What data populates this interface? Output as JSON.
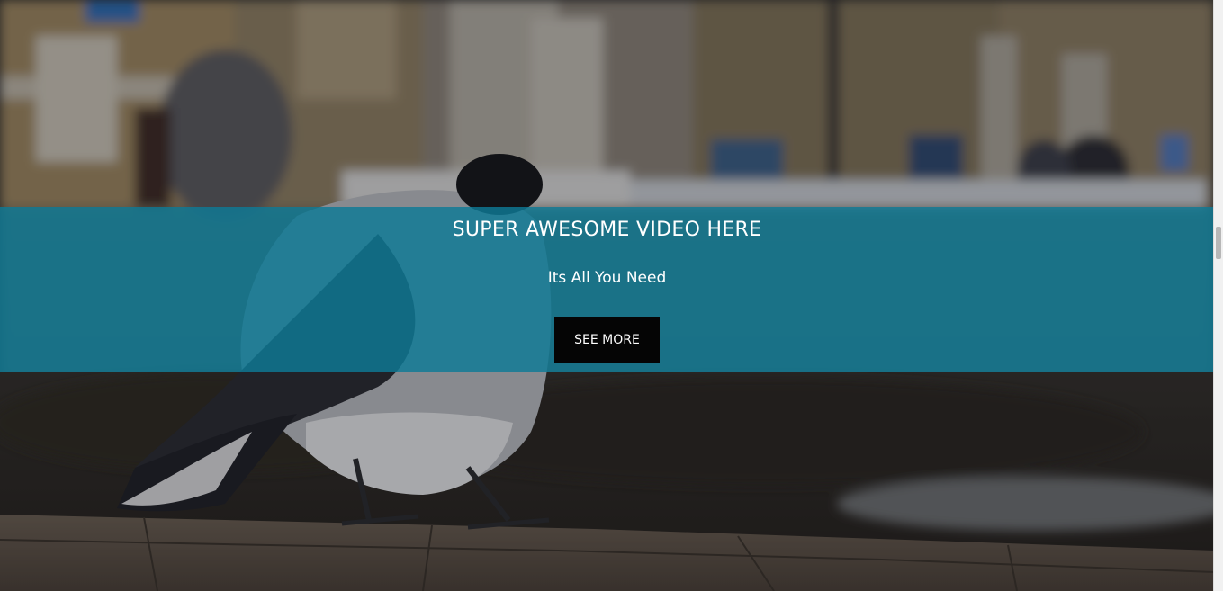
{
  "hero": {
    "title": "SUPER AWESOME VIDEO HERE",
    "subtitle": "Its All You Need",
    "button_label": "SEE MORE"
  },
  "colors": {
    "band": "#0e7a96",
    "button": "#050505",
    "text": "#ffffff"
  }
}
